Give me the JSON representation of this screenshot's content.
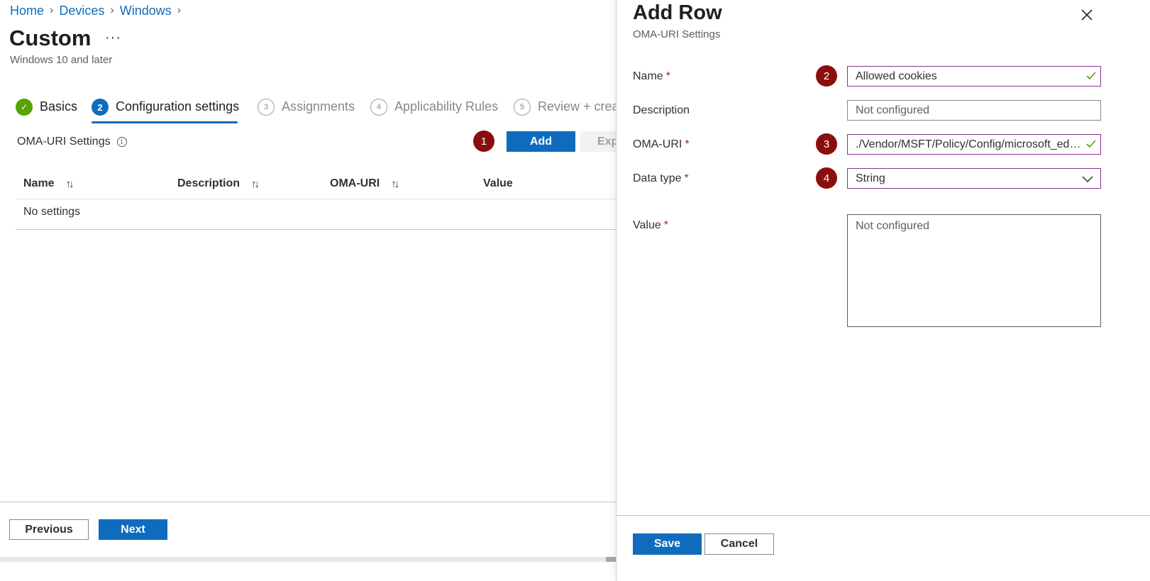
{
  "breadcrumb": {
    "items": [
      "Home",
      "Devices",
      "Windows"
    ]
  },
  "page": {
    "title": "Custom",
    "more": "···",
    "subtitle": "Windows 10 and later"
  },
  "wizard": {
    "steps": [
      {
        "number": "✓",
        "label": "Basics",
        "state": "done"
      },
      {
        "number": "2",
        "label": "Configuration settings",
        "state": "active"
      },
      {
        "number": "3",
        "label": "Assignments",
        "state": "todo"
      },
      {
        "number": "4",
        "label": "Applicability Rules",
        "state": "todo"
      },
      {
        "number": "5",
        "label": "Review + creat",
        "state": "todo"
      }
    ]
  },
  "oma_settings": {
    "label": "OMA-URI Settings",
    "info": "i",
    "add_label": "Add",
    "export_label": "Exp"
  },
  "table": {
    "columns": [
      "Name",
      "Description",
      "OMA-URI",
      "Value"
    ],
    "sort_glyph": "↑↓",
    "empty_text": "No settings"
  },
  "footer": {
    "previous_label": "Previous",
    "next_label": "Next"
  },
  "badges": [
    "1",
    "2",
    "3",
    "4"
  ],
  "panel": {
    "title": "Add Row",
    "subtitle": "OMA-URI Settings",
    "required_marker": "*",
    "fields": {
      "name": {
        "label": "Name",
        "value": "Allowed cookies"
      },
      "description": {
        "label": "Description",
        "value": "Not configured"
      },
      "oma_uri": {
        "label": "OMA-URI",
        "value": "./Vendor/MSFT/Policy/Config/microsoft_edg..."
      },
      "data_type": {
        "label": "Data type",
        "value": "String"
      },
      "value": {
        "label": "Value",
        "value": "Not configured"
      }
    },
    "save_label": "Save",
    "cancel_label": "Cancel"
  },
  "colors": {
    "accent": "#0f6cbd",
    "success": "#57a300",
    "badge": "#8b0e0e",
    "focus_border": "#8c2e92",
    "required": "#a4262c"
  },
  "icons": {
    "close": "close-icon",
    "check": "check-icon",
    "chevron": "chevron-down-icon",
    "info": "info-icon",
    "sort": "sort-icon"
  }
}
